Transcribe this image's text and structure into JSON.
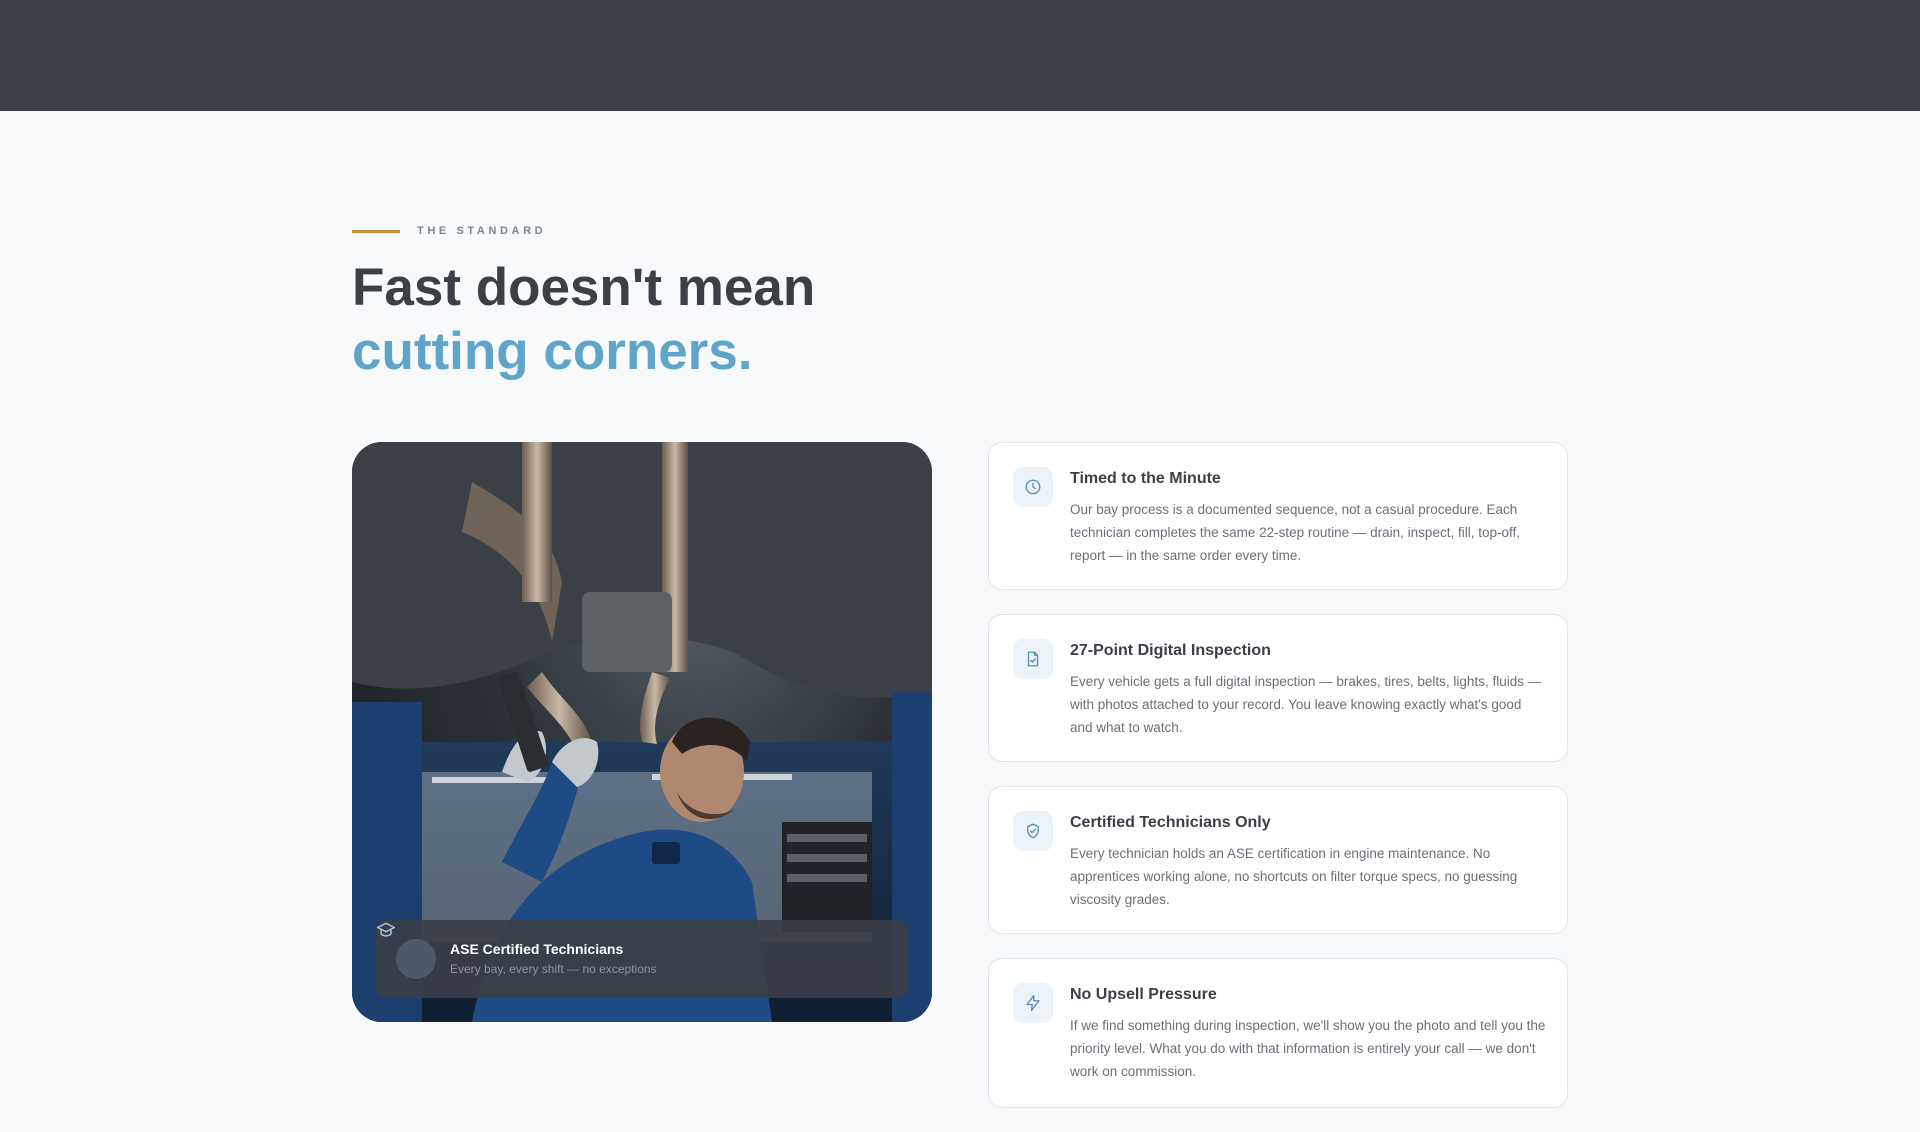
{
  "section": {
    "eyebrow": "THE STANDARD",
    "headline_line1": "Fast doesn't mean",
    "headline_line2": "cutting corners."
  },
  "photo_caption": {
    "icon": "graduation-cap-icon",
    "title": "ASE Certified Technicians",
    "subtitle": "Every bay, every shift — no exceptions"
  },
  "features": [
    {
      "icon": "clock-icon",
      "title": "Timed to the Minute",
      "body": "Our bay process is a documented sequence, not a casual procedure. Each technician completes the same 22-step routine — drain, inspect, fill, top-off, report — in the same order every time."
    },
    {
      "icon": "file-check-icon",
      "title": "27-Point Digital Inspection",
      "body": "Every vehicle gets a full digital inspection — brakes, tires, belts, lights, fluids — with photos attached to your record. You leave knowing exactly what's good and what to watch."
    },
    {
      "icon": "shield-check-icon",
      "title": "Certified Technicians Only",
      "body": "Every technician holds an ASE certification in engine maintenance. No apprentices working alone, no shortcuts on filter torque specs, no guessing viscosity grades."
    },
    {
      "icon": "lightning-icon",
      "title": "No Upsell Pressure",
      "body": "If we find something during inspection, we'll show you the photo and tell you the priority level. What you do with that information is entirely your call — we don't work on commission."
    }
  ],
  "colors": {
    "topbar": "#3b3f48",
    "accent_gold": "#c2903a",
    "accent_blue": "#5fa4c9",
    "heading": "#3c3f46",
    "background": "#f7f9fa"
  }
}
